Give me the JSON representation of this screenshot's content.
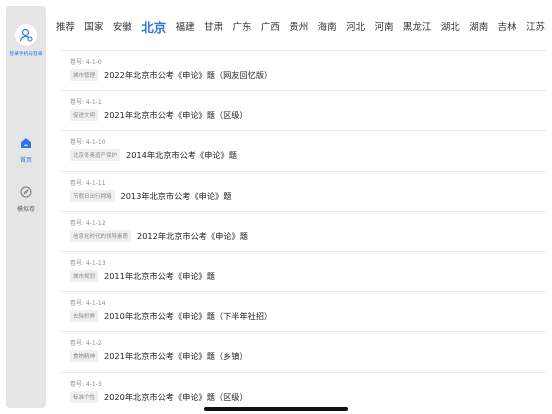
{
  "sidebar": {
    "user_label": "登录手机号登录",
    "nav": [
      {
        "label": "首页",
        "icon": "home-icon",
        "active": true
      },
      {
        "label": "模拟卷",
        "icon": "compass-icon",
        "active": false
      }
    ]
  },
  "tabs": [
    "推荐",
    "国家",
    "安徽",
    "北京",
    "福建",
    "甘肃",
    "广东",
    "广西",
    "贵州",
    "海南",
    "河北",
    "河南",
    "黑龙江",
    "湖北",
    "湖南",
    "吉林",
    "江苏"
  ],
  "active_tab": "北京",
  "colors": {
    "accent": "#2f74e0",
    "sidebar_bg": "#e5e5e5",
    "tag_bg": "#f0f0f0"
  },
  "items": [
    {
      "code": "卷号: 4-1-0",
      "tag": "城市管理",
      "title": "2022年北京市公考《申论》题（网友回忆版）"
    },
    {
      "code": "卷号: 4-1-1",
      "tag": "促进文明",
      "title": "2021年北京市公考《申论》题（区级）"
    },
    {
      "code": "卷号: 4-1-10",
      "tag": "北京冬奥遗产保护",
      "title": "2014年北京市公考《申论》题"
    },
    {
      "code": "卷号: 4-1-11",
      "tag": "节假日出行拥堵",
      "title": "2013年北京市公考《申论》题"
    },
    {
      "code": "卷号: 4-1-12",
      "tag": "信息化时代的领导素质",
      "title": "2012年北京市公考《申论》题"
    },
    {
      "code": "卷号: 4-1-13",
      "tag": "城市规划",
      "title": "2011年北京市公考《申论》题"
    },
    {
      "code": "卷号: 4-1-14",
      "tag": "去除积弊",
      "title": "2010年北京市公考《申论》题（下半年社招）"
    },
    {
      "code": "卷号: 4-1-2",
      "tag": "食物精神",
      "title": "2021年北京市公考《申论》题（乡镇）"
    },
    {
      "code": "卷号: 4-1-3",
      "tag": "标准个性",
      "title": "2020年北京市公考《申论》题（区级）"
    }
  ]
}
